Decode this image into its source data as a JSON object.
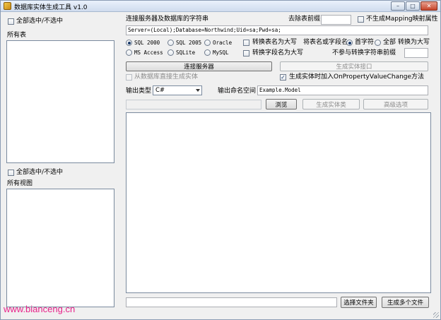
{
  "window": {
    "title": "数据库实体生成工具 v1.0",
    "minimize_glyph": "–",
    "maximize_glyph": "□",
    "close_glyph": "✕"
  },
  "left_panel": {
    "tables_select_all": "全部选中/不选中",
    "tables_label": "所有表",
    "views_select_all": "全部选中/不选中",
    "views_label": "所有视图"
  },
  "connection": {
    "label": "连接服务器及数据库的字符串",
    "remove_prefix_label": "去除表前缀",
    "remove_prefix_value": "",
    "no_mapping_label": "不生成Mapping映射属性",
    "connection_string": "Server=(Local);Database=Northwind;Uid=sa;Pwd=sa;",
    "db_types": [
      {
        "label": "SQL 2000",
        "selected": true
      },
      {
        "label": "SQL 2005",
        "selected": false
      },
      {
        "label": "Oracle",
        "selected": false
      },
      {
        "label": "MS Access",
        "selected": false
      },
      {
        "label": "SQLite",
        "selected": false
      },
      {
        "label": "MySQL",
        "selected": false
      }
    ],
    "table_upper_label": "转换表名为大写",
    "field_upper_label": "转换字段名为大写",
    "convert_label": "将表名或字段名",
    "first_char_label": "首字符",
    "all_label": "全部",
    "to_upper_label": "转换为大写",
    "exclude_prefix_label": "不参与转换字符串前缀",
    "exclude_prefix_value": "",
    "connect_button": "连接服务器",
    "gen_interface_button": "生成实体接口",
    "direct_gen_label": "从数据库直接生成实体",
    "property_change_label": "生成实体时加入OnPropertyValueChange方法"
  },
  "output": {
    "type_label": "输出类型",
    "type_value": "C#",
    "namespace_label": "输出命名空间",
    "namespace_value": "Example.Model",
    "browse_button": "浏览",
    "gen_entity_button": "生成实体类",
    "advanced_button": "高级选项",
    "folder_path_value": "",
    "select_folder_button": "选择文件夹",
    "gen_multi_button": "生成多个文件"
  },
  "watermark": "www.bianceng.cn"
}
